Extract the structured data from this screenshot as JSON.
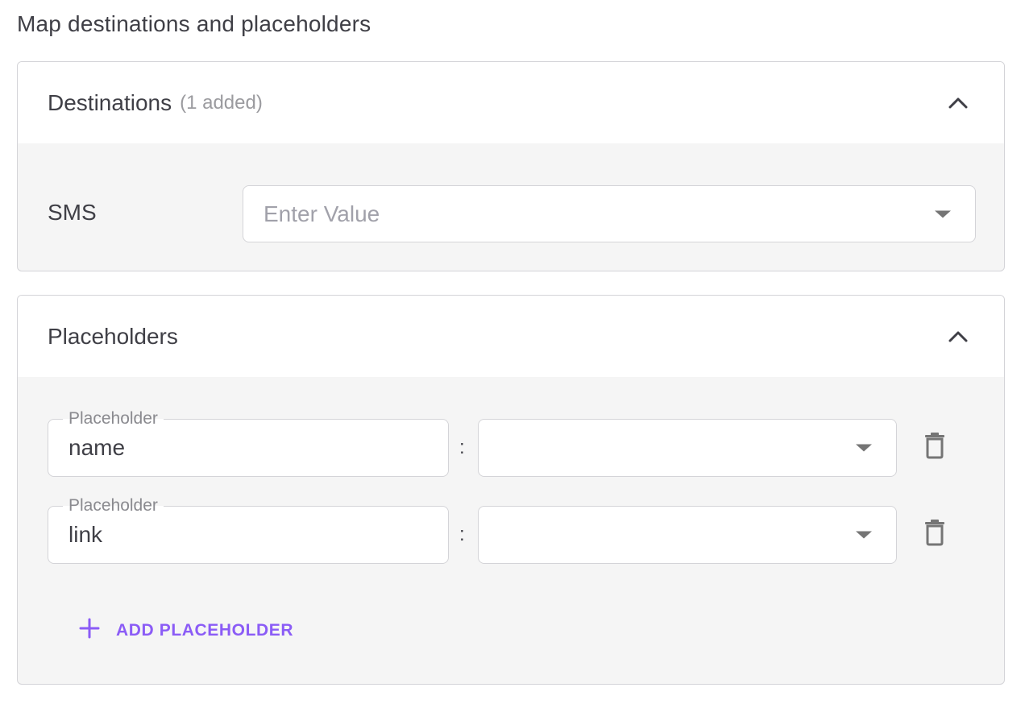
{
  "page": {
    "title": "Map destinations and placeholders"
  },
  "destinations": {
    "title": "Destinations",
    "count_text": "(1 added)",
    "rows": [
      {
        "label": "SMS",
        "placeholder": "Enter Value"
      }
    ]
  },
  "placeholders": {
    "title": "Placeholders",
    "rows": [
      {
        "field_label": "Placeholder",
        "value": "name",
        "separator": ":"
      },
      {
        "field_label": "Placeholder",
        "value": "link",
        "separator": ":"
      }
    ],
    "add_button_label": "ADD PLACEHOLDER"
  },
  "colors": {
    "accent": "#8b5cf6",
    "text": "#3f3f46",
    "muted": "#9b9b9f",
    "panel_bg": "#f5f5f5",
    "border": "#d4d4d8"
  },
  "icons": [
    "chevron-up-icon",
    "dropdown-caret-icon",
    "trash-icon",
    "plus-icon"
  ]
}
